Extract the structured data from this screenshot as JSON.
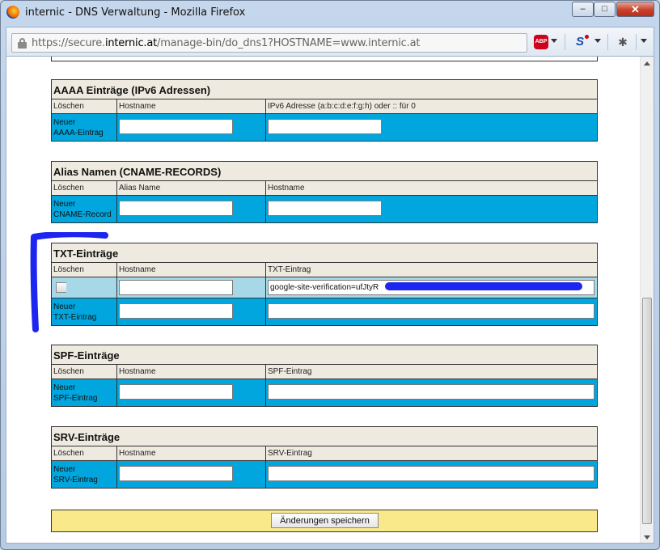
{
  "window": {
    "title": "internic - DNS Verwaltung - Mozilla Firefox",
    "minimize": "–",
    "maximize": "□",
    "close": "✕"
  },
  "addressbar": {
    "url_prefix": "https://secure.",
    "url_domain": "internic.at",
    "url_path": "/manage-bin/do_dns1?HOSTNAME=www.internic.at",
    "adblock_label": "ABP",
    "s_label": "S"
  },
  "sections": {
    "aaaa": {
      "title": "AAAA Einträge (IPv6 Adressen)",
      "col1": "Löschen",
      "col2": "Hostname",
      "col3": "IPv6 Adresse (a:b:c:d:e:f:g:h) oder :: für 0",
      "new_line1": "Neuer",
      "new_line2": "AAAA-Eintrag"
    },
    "cname": {
      "title": "Alias Namen (CNAME-RECORDS)",
      "col1": "Löschen",
      "col2": "Alias Name",
      "col3": "Hostname",
      "new_line1": "Neuer",
      "new_line2": "CNAME-Record"
    },
    "txt": {
      "title": "TXT-Einträge",
      "col1": "Löschen",
      "col2": "Hostname",
      "col3": "TXT-Eintrag",
      "existing_value": "google-site-verification=ufJtyR",
      "new_line1": "Neuer",
      "new_line2": "TXT-Eintrag"
    },
    "spf": {
      "title": "SPF-Einträge",
      "col1": "Löschen",
      "col2": "Hostname",
      "col3": "SPF-Eintrag",
      "new_line1": "Neuer",
      "new_line2": "SPF-Eintrag"
    },
    "srv": {
      "title": "SRV-Einträge",
      "col1": "Löschen",
      "col2": "Hostname",
      "col3": "SRV-Eintrag",
      "new_line1": "Neuer",
      "new_line2": "SRV-Eintrag"
    }
  },
  "save_button": "Änderungen speichern",
  "colors": {
    "row_blue": "#00a6dd",
    "row_light": "#a6d8e8",
    "header_beige": "#eeeae0",
    "save_bar": "#fae98a",
    "marker": "#1c26f0"
  }
}
